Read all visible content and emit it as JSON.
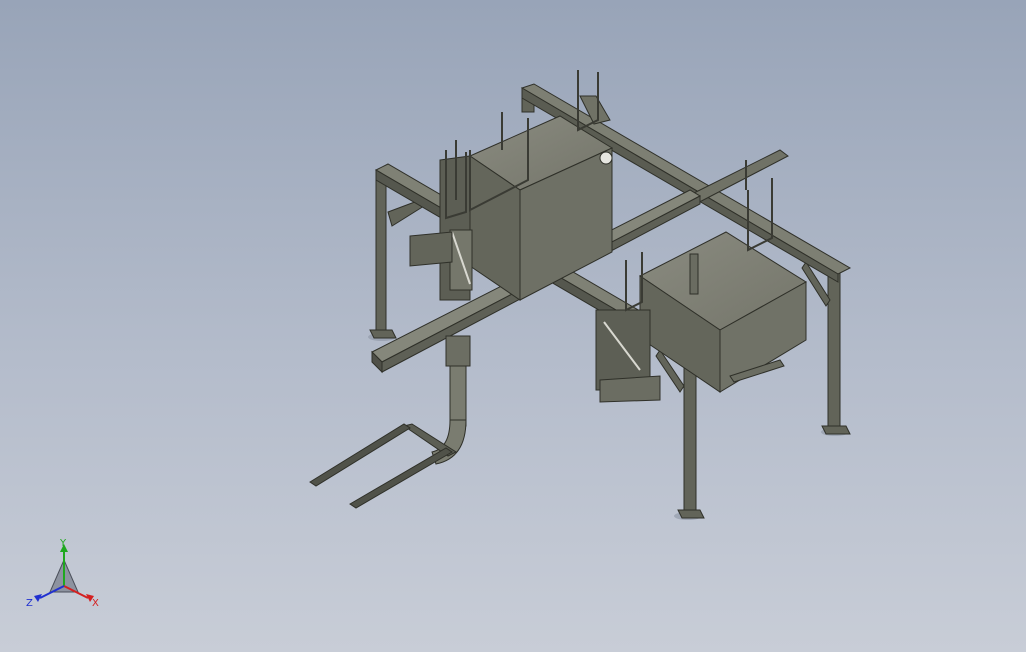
{
  "view": {
    "name": "3d-model-graphics-area",
    "background_top": "#98a4b8",
    "background_bottom": "#c8cdd7",
    "model_color": "#6d6f63"
  },
  "triad": {
    "x_label": "X",
    "y_label": "Y",
    "z_label": "Z",
    "x_color": "#d42020",
    "y_color": "#1fa81f",
    "z_color": "#2030d0"
  }
}
